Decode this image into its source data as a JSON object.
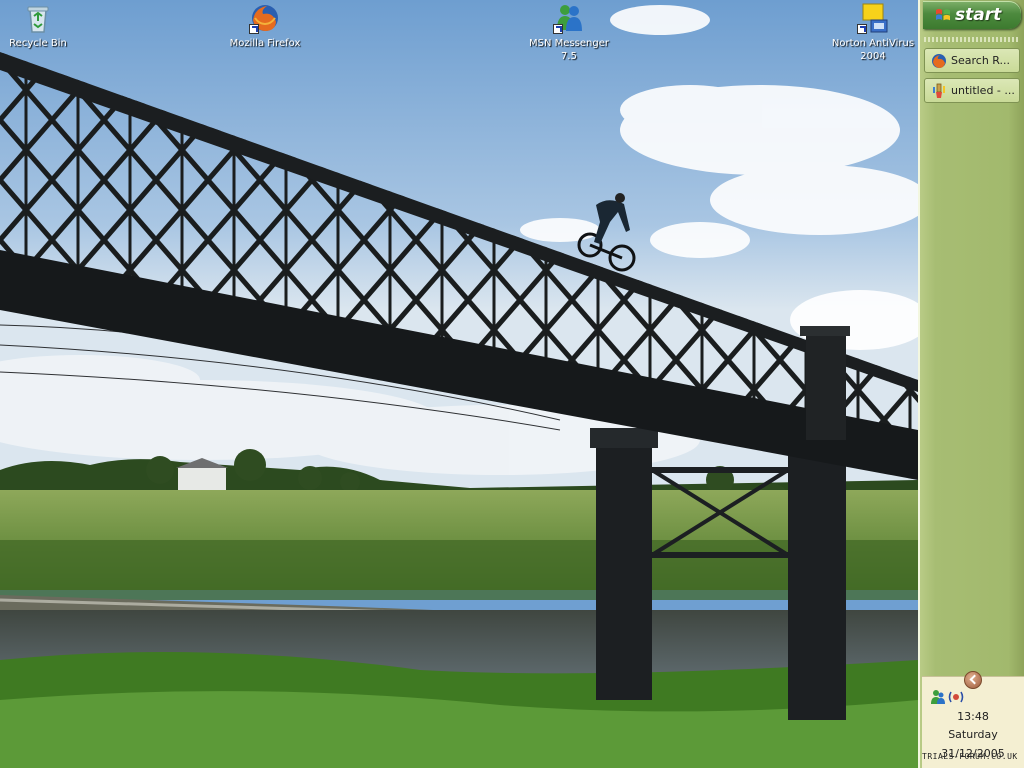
{
  "desktop": {
    "icons": [
      {
        "label": "Recycle Bin",
        "icon": "recycle-bin-icon"
      },
      {
        "label": "Mozilla Firefox",
        "icon": "firefox-icon"
      },
      {
        "label": "MSN Messenger 7.5",
        "icon": "msn-messenger-icon"
      },
      {
        "label": "Norton AntiVirus 2004",
        "icon": "norton-antivirus-icon"
      }
    ]
  },
  "taskbar": {
    "start_label": "start",
    "buttons": [
      {
        "label": "Search R...",
        "icon": "firefox-icon"
      },
      {
        "label": "untitled - ...",
        "icon": "paint-icon"
      }
    ]
  },
  "tray": {
    "time": "13:48",
    "day": "Saturday",
    "date": "31/12/2005"
  },
  "watermark": "TRIALS-FORUM.CO.UK",
  "colors": {
    "taskbar": "#a2b96d",
    "start_button": "#4d8a3e",
    "tray": "#f4efd2"
  }
}
